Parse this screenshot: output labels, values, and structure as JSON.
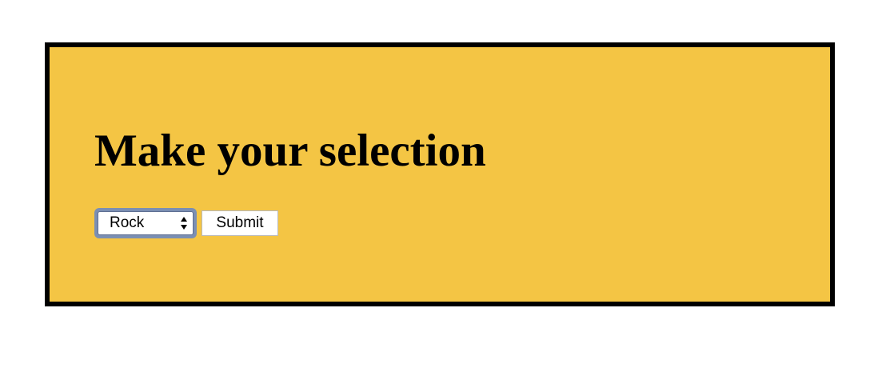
{
  "page": {
    "title": "Make your selection"
  },
  "form": {
    "selection": {
      "selected": "Rock"
    },
    "submit_label": "Submit"
  },
  "colors": {
    "panel_background": "#f4c544",
    "panel_border": "#000000",
    "page_background": "#ffffff",
    "select_focus_ring": "#7b8fb3"
  },
  "icons": {
    "select_arrows": "up-down-chevron-icon"
  }
}
